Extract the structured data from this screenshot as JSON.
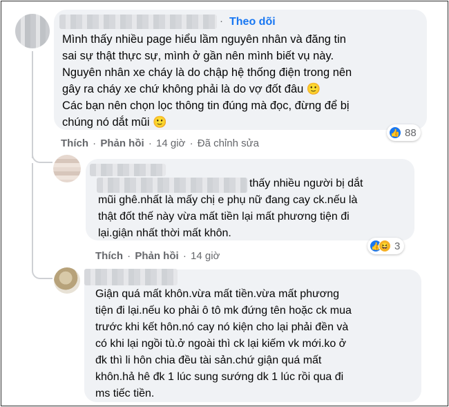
{
  "comments": [
    {
      "follow_label": "Theo dõi",
      "lines": [
        "Mình thấy nhiều page hiểu lầm nguyên nhân và đăng tin",
        "sai sự thật thực sự, mình ở gần nên mình biết vụ này.",
        "Nguyên nhân xe cháy là do chập hệ thống điện trong nên",
        "gây ra cháy xe chứ không phải là do vợ đốt đâu 🙂",
        "Các bạn nên chọn lọc thông tin đúng mà đọc, đừng để bị",
        "chúng nó dắt mũi 🙂"
      ],
      "actions": {
        "like": "Thích",
        "reply": "Phản hồi",
        "time": "14 giờ",
        "edited": "Đã chỉnh sửa",
        "sep": "·"
      },
      "reactions": {
        "count": "88",
        "icons": [
          "like-icon"
        ]
      }
    },
    {
      "lines": [
        "thấy nhiều người bị dắt",
        "mũi ghê.nhất là mấy chị e phụ nữ đang cay ck.nếu là",
        "thật đốt thế này vừa mất tiền lại mất phương tiện đi",
        "lại.giận nhất thời mất khôn."
      ],
      "actions": {
        "like": "Thích",
        "reply": "Phản hồi",
        "time": "14 giờ",
        "sep": "·"
      },
      "reactions": {
        "count": "3",
        "icons": [
          "like-icon",
          "haha-icon"
        ]
      }
    },
    {
      "lines": [
        "Giận quá mất khôn.vừa mất tiền.vừa mất phương",
        "tiện đi lại.nếu ko phải ô tô mk đứng tên hoặc ck mua",
        "trước khi kết hôn.nó cay nó kiện cho lại phải đền và",
        "có khi lại ngồi tù.ở ngoài thì ck lại kiếm vk mới.ko ở",
        "đk thì li hôn chia đều tài sản.chứ giận quá mất",
        "khôn.hả hê đk 1 lúc sung sướng dk 1 lúc rồi qua đi",
        "ms tiếc tiền."
      ]
    }
  ],
  "colors": {
    "bubble": "#f0f2f5",
    "accent": "#1877f2",
    "meta": "#65676b",
    "text": "#050505"
  }
}
